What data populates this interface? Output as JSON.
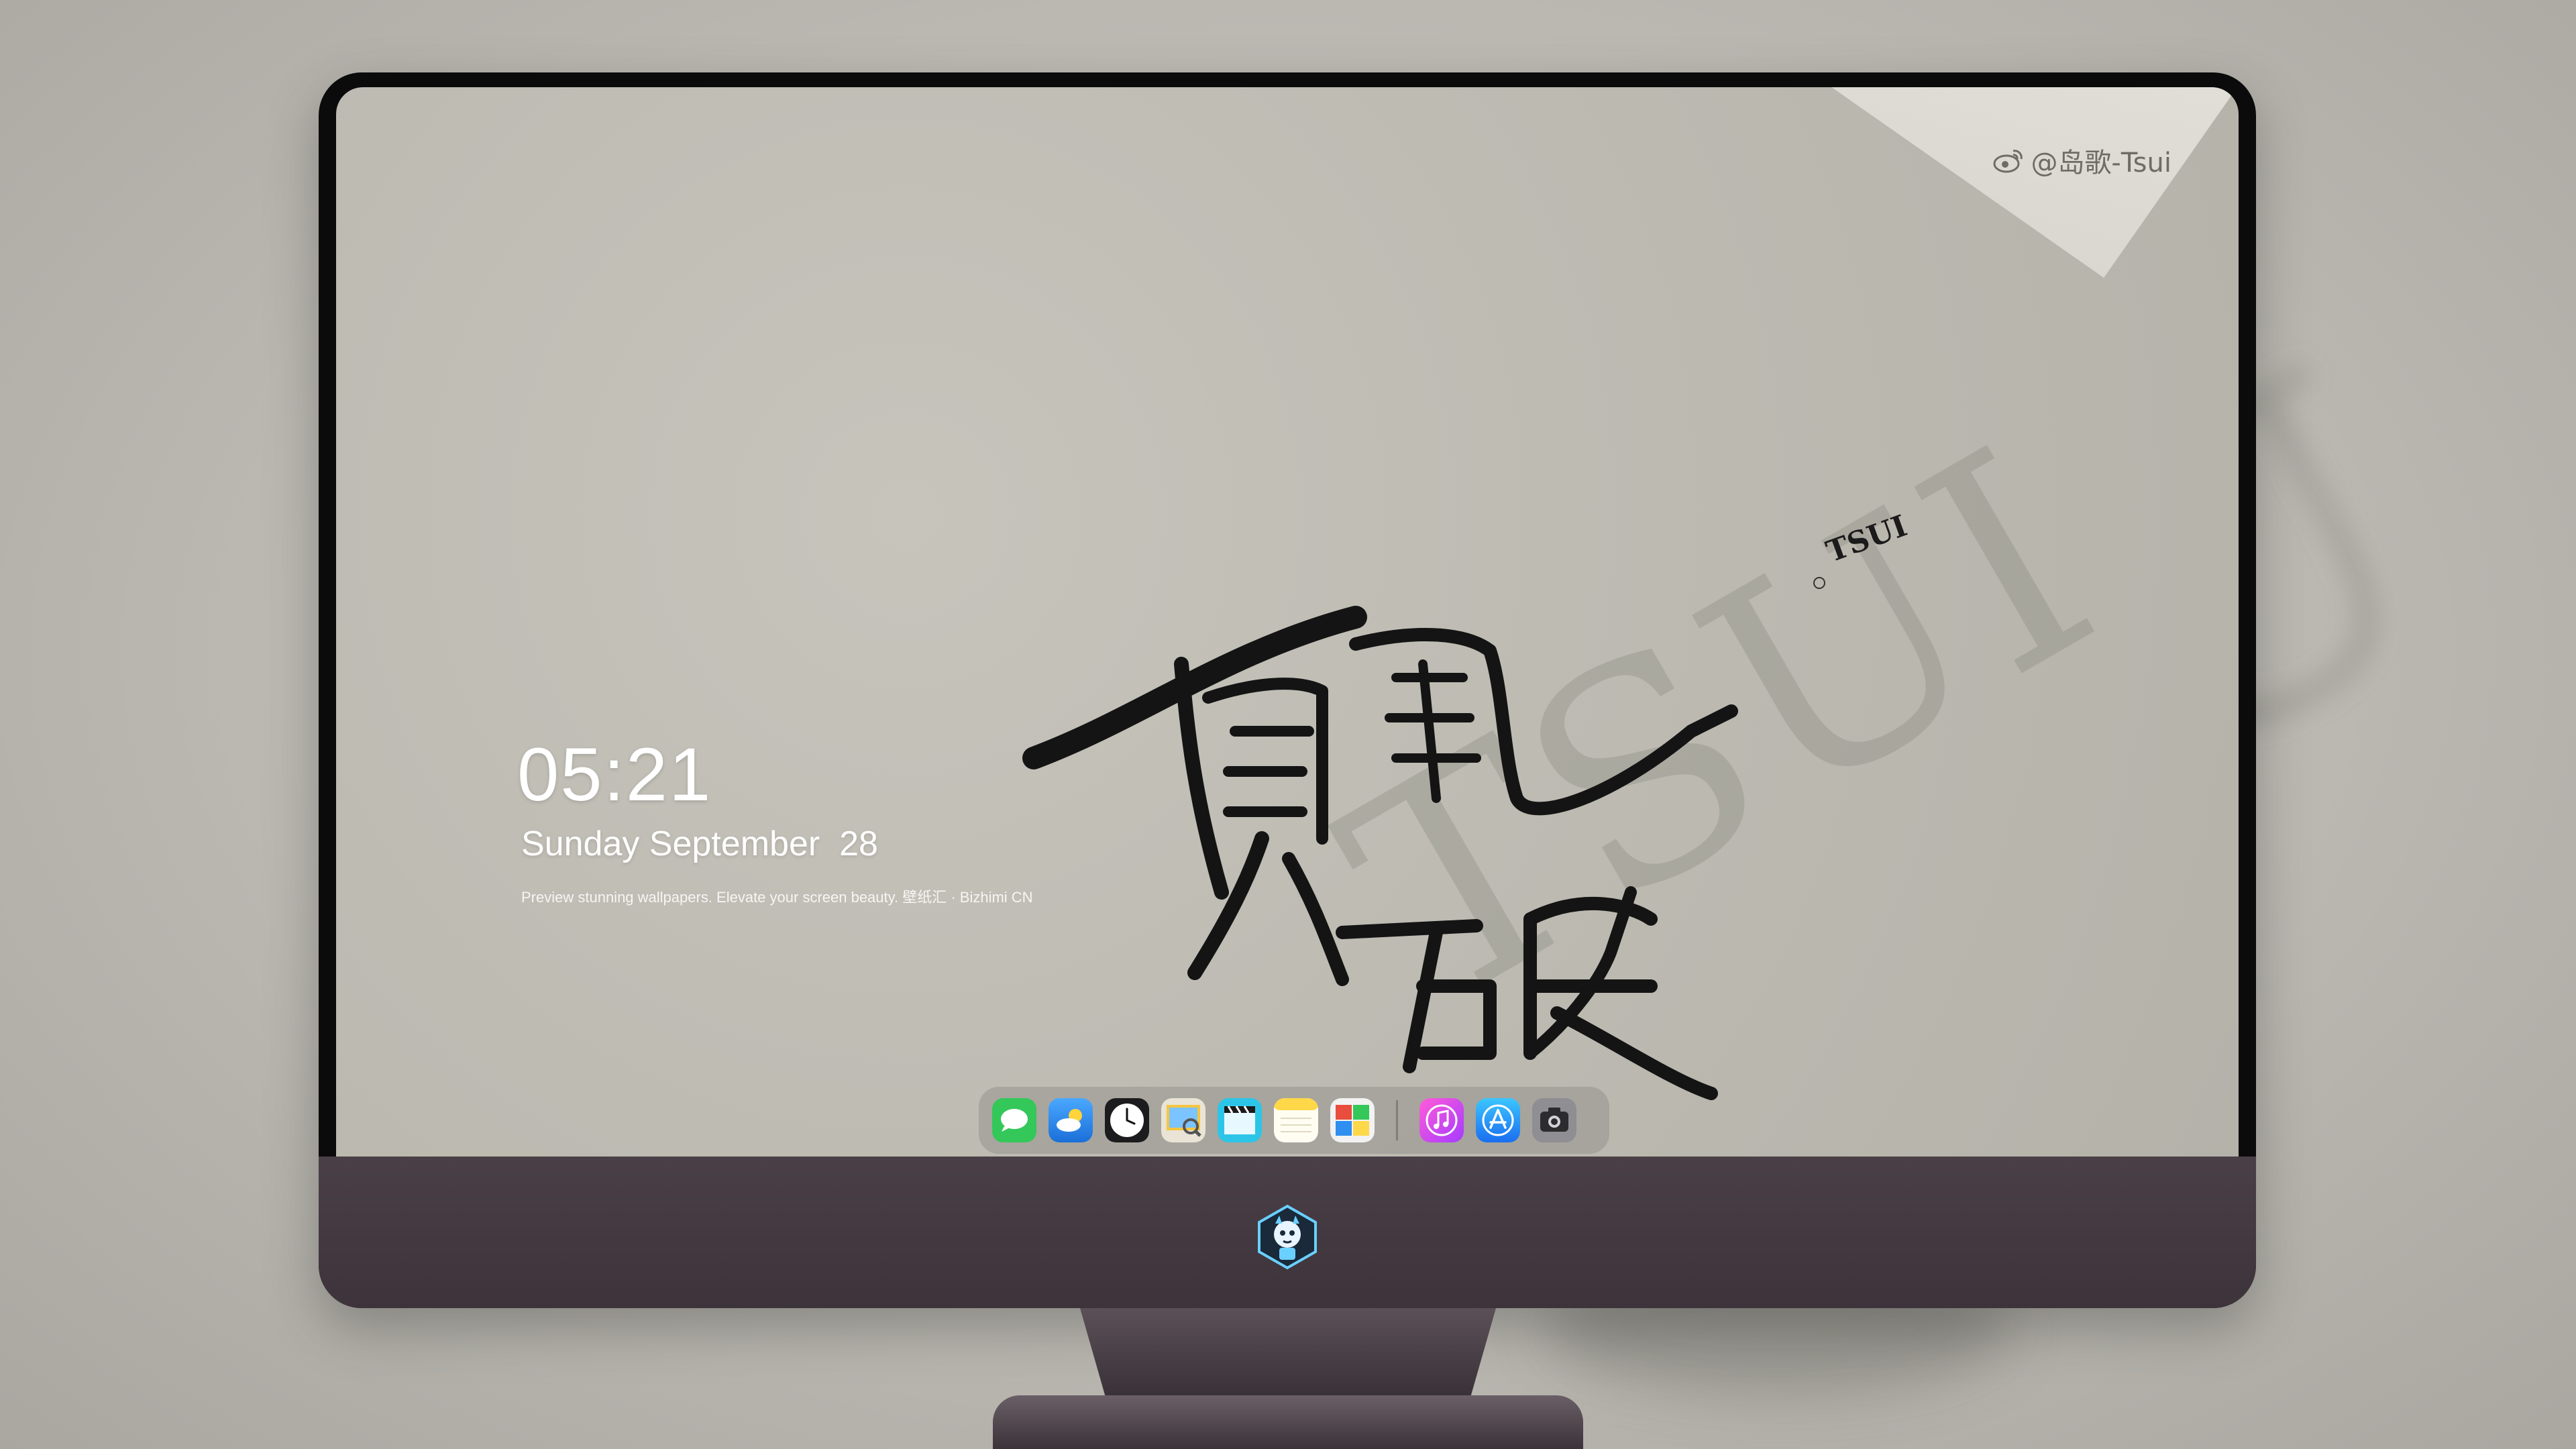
{
  "lockscreen": {
    "time": "05:21",
    "date": "Sunday September  28",
    "tagline": "Preview stunning wallpapers. Elevate your screen beauty. 壁纸汇 · Bizhimi CN"
  },
  "wallpaper": {
    "weibo_handle": "@岛歌-Tsui",
    "signature_mark": "TSUI",
    "watermark_text": "TSUI",
    "background_watermark": "TSU"
  },
  "dock": {
    "apps": [
      {
        "name": "messages-icon",
        "color": "#34c759"
      },
      {
        "name": "weather-icon",
        "color": "#2f8ff0"
      },
      {
        "name": "clock-icon",
        "color": "#ffffff"
      },
      {
        "name": "preview-icon",
        "color": "#f5c542"
      },
      {
        "name": "final-cut-icon",
        "color": "#2cc5e8"
      },
      {
        "name": "notes-icon",
        "color": "#ffd84a"
      },
      {
        "name": "photo-booth-icon",
        "color": "#e84d3d"
      },
      {
        "name": "itunes-icon",
        "color": "#e84fe1"
      },
      {
        "name": "app-store-icon",
        "color": "#1e9bff"
      },
      {
        "name": "camera-icon",
        "color": "#8e8e93"
      }
    ]
  },
  "colors": {
    "chin": "#3d333a",
    "bezel": "#0b0b0c",
    "paper": "#bdbbb2"
  }
}
